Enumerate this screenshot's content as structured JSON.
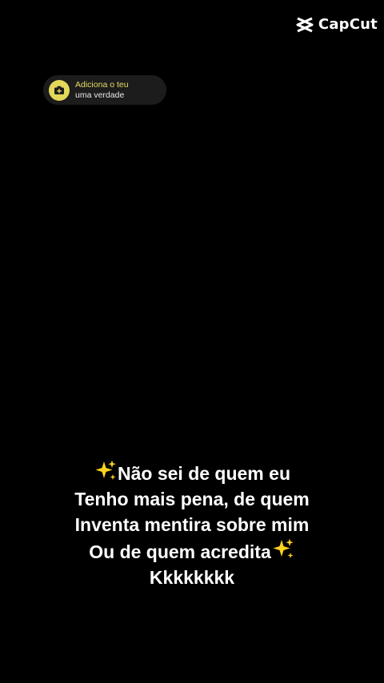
{
  "watermark": {
    "brand": "CapCut",
    "icon": "capcut-logo-icon"
  },
  "sticker": {
    "line1": "Adiciona o teu",
    "line2": "uma verdade",
    "icon": "add-photo-icon",
    "accent": "#e3d85a"
  },
  "caption": {
    "line1": "Não sei de quem eu",
    "line2": "Tenho mais pena, de quem",
    "line3": "Inventa mentira sobre mim",
    "line4": "Ou de quem acredita",
    "line5": "Kkkkkkkk",
    "emoji": "sparkles-icon"
  }
}
